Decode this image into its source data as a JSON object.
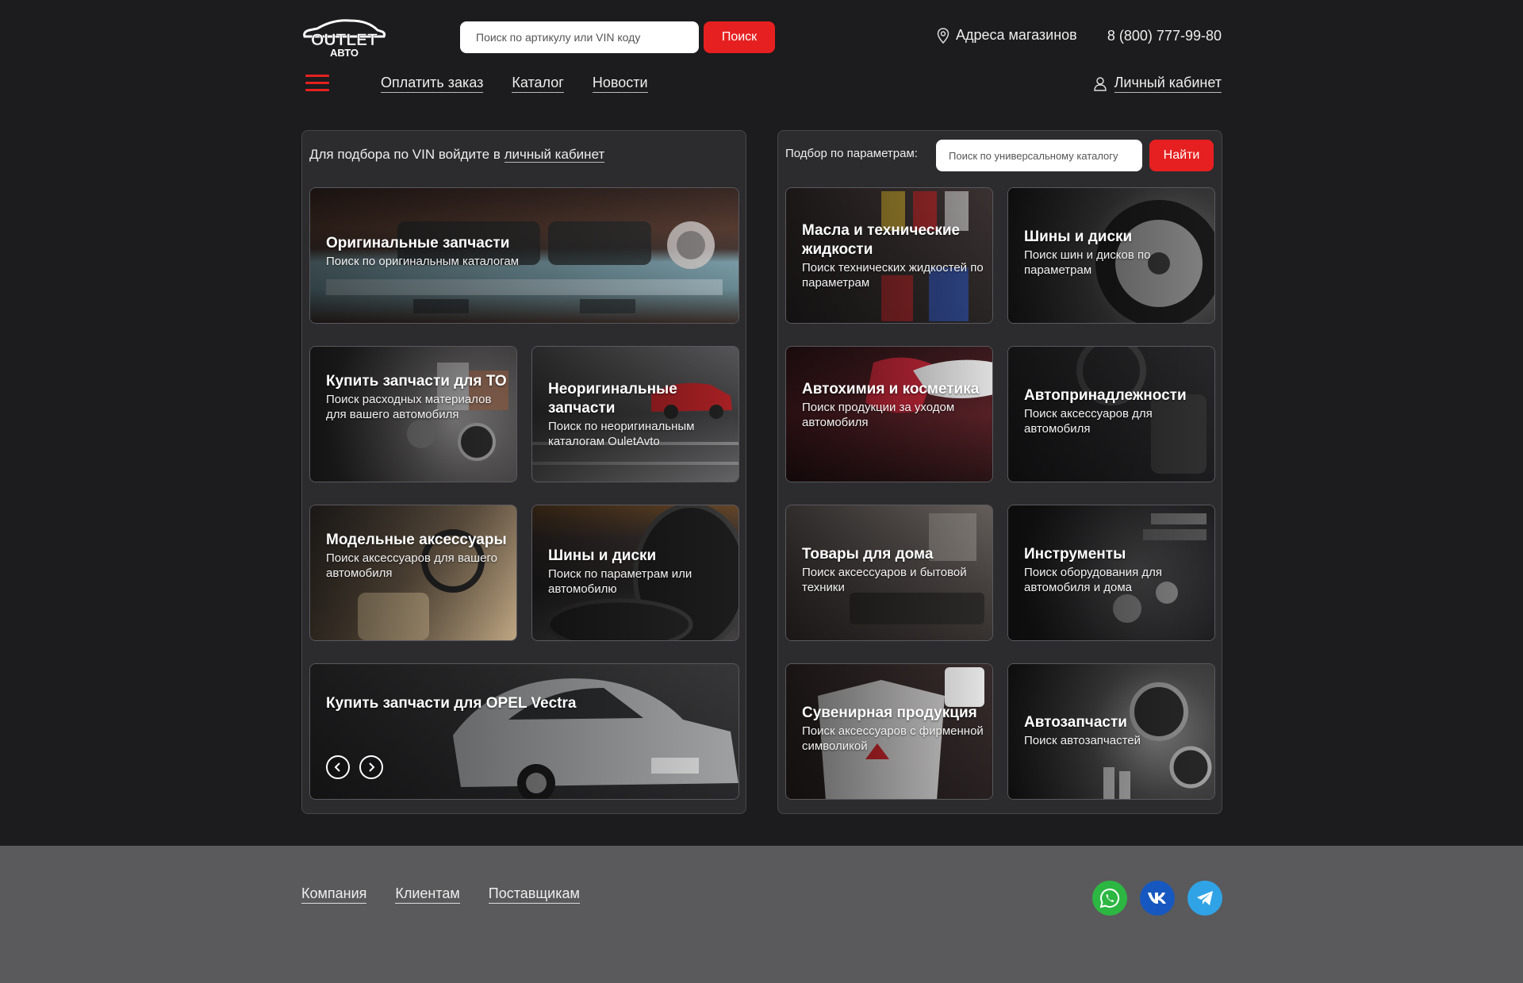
{
  "header": {
    "logo_text_top": "OUTLET",
    "logo_text_bottom": "АВТО",
    "search_placeholder": "Поиск по артикулу или VIN коду",
    "search_button": "Поиск",
    "stores_link": "Адреса магазинов",
    "phone": "8 (800) 777-99-80",
    "nav": [
      "Оплатить заказ",
      "Каталог",
      "Новости"
    ],
    "cabinet": "Личный кабинет"
  },
  "left_panel": {
    "vin_prefix": "Для подбора по VIN войдите в ",
    "vin_link": "личный кабинет",
    "cards": [
      {
        "title": "Оригинальные запчасти",
        "subtitle": "Поиск по оригинальным каталогам",
        "image": "car-front"
      },
      {
        "title": "Купить запчасти для ТО",
        "subtitle": "Поиск расходных материалов для вашего автомобиля",
        "image": "parts"
      },
      {
        "title": "Неоригинальные запчасти",
        "subtitle": "Поиск по неоригинальным каталогам OuletAvto",
        "image": "garage"
      },
      {
        "title": "Модельные аксессуары",
        "subtitle": "Поиск аксессуаров для вашего автомобиля",
        "image": "interior"
      },
      {
        "title": "Шины и диски",
        "subtitle": "Поиск по параметрам или автомобилю",
        "image": "tires"
      },
      {
        "title": "Купить запчасти для OPEL Vectra",
        "subtitle": "",
        "image": "opel"
      }
    ]
  },
  "right_panel": {
    "param_label": "Подбор по параметрам:",
    "param_placeholder": "Поиск по универсальному каталогу",
    "param_button": "Найти",
    "cards": [
      {
        "title": "Масла и технические жидкости",
        "subtitle": "Поиск технических жидкостей по  параметрам",
        "image": "oils"
      },
      {
        "title": "Шины и диски",
        "subtitle": "Поиск шин и дисков по параметрам",
        "image": "wheel"
      },
      {
        "title": "Автохимия и косметика",
        "subtitle": "Поиск продукции за уходом автомобиля",
        "image": "polish"
      },
      {
        "title": "Автопринадлежности",
        "subtitle": "Поиск аксессуаров для автомобиля",
        "image": "dashboard"
      },
      {
        "title": "Товары для дома",
        "subtitle": "Поиск аксессуаров и бытовой техники",
        "image": "home"
      },
      {
        "title": "Инструменты",
        "subtitle": "Поиск оборудования для автомобиля и дома",
        "image": "tools"
      },
      {
        "title": "Сувенирная продукция",
        "subtitle": "Поиск аксессуаров с фирменной символикой",
        "image": "souvenir"
      },
      {
        "title": "Автозапчасти",
        "subtitle": "Поиск автозапчастей",
        "image": "autoparts"
      }
    ]
  },
  "footer": {
    "links": [
      "Компания",
      "Клиентам",
      "Поставщикам"
    ],
    "socials": [
      "whatsapp-icon",
      "vk-icon",
      "telegram-icon"
    ]
  },
  "colors": {
    "accent": "#e62020",
    "background": "#1c1b1d",
    "panel": "#2c2b2e",
    "footer": "#5a5a5c"
  }
}
